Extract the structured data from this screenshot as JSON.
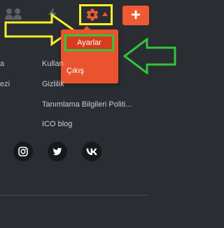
{
  "header": {
    "plus_label": "+",
    "icons": [
      "users-icon",
      "bolt-icon",
      "gear-icon",
      "caret-up-icon"
    ]
  },
  "dropdown": {
    "items": [
      {
        "label": "Ayarlar",
        "icon": "none"
      },
      {
        "label": "Çıkış",
        "icon": "none"
      }
    ]
  },
  "footer": {
    "left_fragments": [
      "a",
      "ezi"
    ],
    "links": [
      "Kullan",
      "Gizlilik",
      "Tanımlama Bilgileri Politi...",
      "ICO blog"
    ],
    "social": [
      "instagram-icon",
      "twitter-icon",
      "vk-icon"
    ]
  },
  "annotations": {
    "yellow_color": "#f7ef2a",
    "green_color": "#33c43d"
  }
}
